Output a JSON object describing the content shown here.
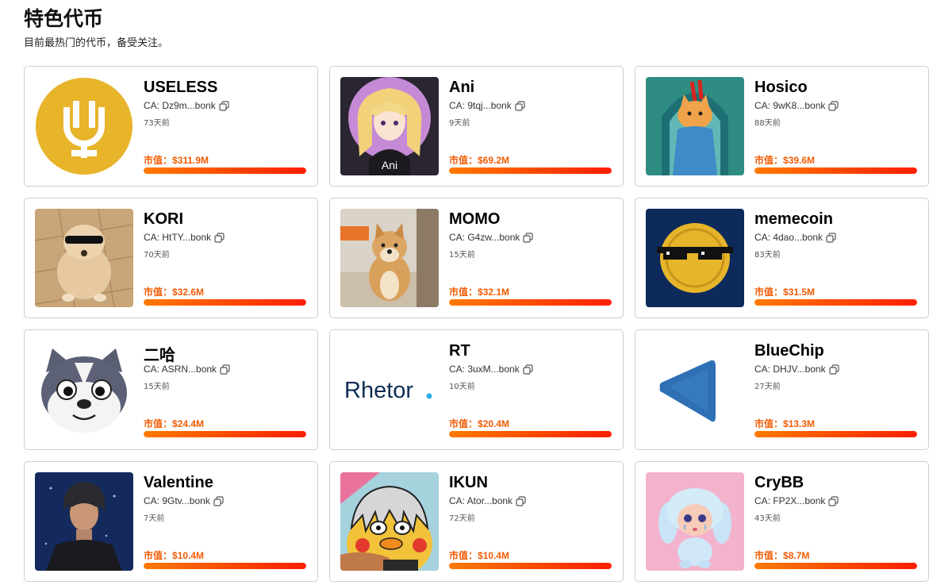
{
  "header": {
    "title": "特色代币",
    "subtitle": "目前最热门的代币，备受关注。"
  },
  "labels": {
    "market_cap_prefix": "市值："
  },
  "colors": {
    "accent": "#f25c05",
    "bar_start": "#ff7a00",
    "bar_end": "#ff1e00"
  },
  "tokens": [
    {
      "name": "USELESS",
      "ca": "CA: Dz9m...bonk",
      "age": "73天前",
      "market_cap": "$311.9M",
      "progress": 1.0,
      "image": "useless-logo"
    },
    {
      "name": "Ani",
      "ca": "CA: 9tqj...bonk",
      "age": "9天前",
      "market_cap": "$69.2M",
      "progress": 1.0,
      "image": "anime-girl-avatar",
      "image_text": "Ani"
    },
    {
      "name": "Hosico",
      "ca": "CA: 9wK8...bonk",
      "age": "88天前",
      "market_cap": "$39.6M",
      "progress": 1.0,
      "image": "cat-in-blanket"
    },
    {
      "name": "KORI",
      "ca": "CA: HtTY...bonk",
      "age": "70天前",
      "market_cap": "$32.6M",
      "progress": 1.0,
      "image": "dog-with-sunglasses"
    },
    {
      "name": "MOMO",
      "ca": "CA: G4zw...bonk",
      "age": "15天前",
      "market_cap": "$32.1M",
      "progress": 1.0,
      "image": "shiba-dog-photo"
    },
    {
      "name": "memecoin",
      "ca": "CA: 4dao...bonk",
      "age": "83天前",
      "market_cap": "$31.5M",
      "progress": 1.0,
      "image": "coin-with-sunglasses"
    },
    {
      "name": "二哈",
      "ca": "CA: ASRN...bonk",
      "age": "15天前",
      "market_cap": "$24.4M",
      "progress": 1.0,
      "image": "husky-cartoon"
    },
    {
      "name": "RT",
      "ca": "CA: 3uxM...bonk",
      "age": "10天前",
      "market_cap": "$20.4M",
      "progress": 1.0,
      "image": "rhetor-wordmark",
      "image_text": "Rhetor"
    },
    {
      "name": "BlueChip",
      "ca": "CA: DHJV...bonk",
      "age": "27天前",
      "market_cap": "$13.3M",
      "progress": 1.0,
      "image": "blue-chip-triangle"
    },
    {
      "name": "Valentine",
      "ca": "CA: 9Gtv...bonk",
      "age": "7天前",
      "market_cap": "$10.4M",
      "progress": 1.0,
      "image": "anime-man-portrait"
    },
    {
      "name": "IKUN",
      "ca": "CA: Ator...bonk",
      "age": "72天前",
      "market_cap": "$10.4M",
      "progress": 1.0,
      "image": "chick-cartoon"
    },
    {
      "name": "CryBB",
      "ca": "CA: FP2X...bonk",
      "age": "43天前",
      "market_cap": "$8.7M",
      "progress": 1.0,
      "image": "crybaby-figure"
    }
  ]
}
